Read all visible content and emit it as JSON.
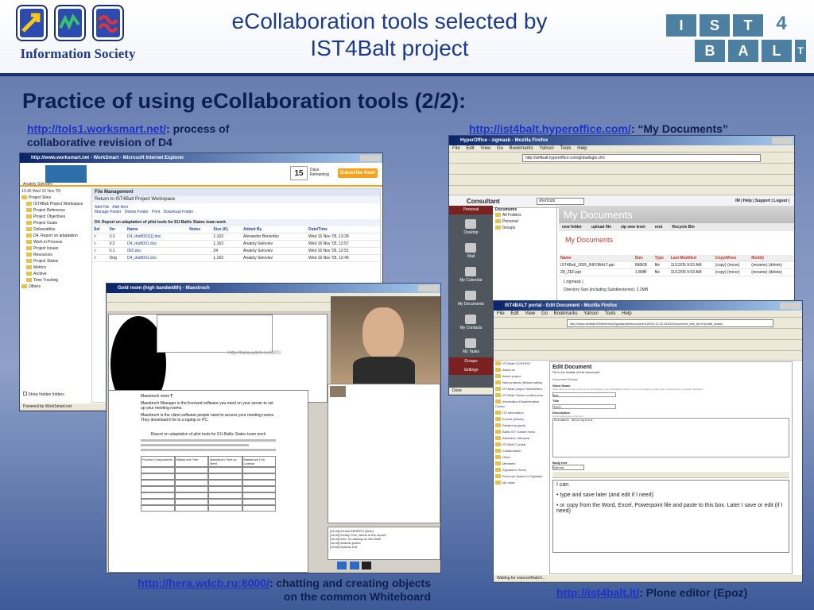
{
  "header": {
    "title_line1": "eCollaboration tools selected by",
    "title_line2": "IST4Balt project",
    "is_logo_text": "Information Society",
    "ist_letters": [
      "I",
      "S",
      "T",
      "4",
      "B",
      "A",
      "L",
      "T"
    ]
  },
  "slide": {
    "subtitle": "Practice of using eCollaboration tools (2/2):",
    "captions": {
      "worksmart_link": "http://tols1.worksmart.net/",
      "worksmart_text": ": process of",
      "worksmart_text2": "collaborative revision of D4",
      "hyperoffice_link": "http://ist4balt.hyperoffice.com/",
      "hyperoffice_text": ": “My Documents”",
      "wdcb_link": "http://hera.wdcb.ru:8000/",
      "wdcb_text": ": chatting and creating objects",
      "wdcb_text2": "on the common Whiteboard",
      "plone_link": "http://ist4balt.lt/",
      "plone_text": ": Plone editor (Epoz)"
    }
  },
  "worksmart": {
    "window_title": "http://www.worksmart.net - WorkSmart - Microsoft Internet Explorer",
    "user_name": "Anatoly Soloviev",
    "user_time": "13:45 Wed 16 Nov '05",
    "days_count": "15",
    "days_label": "Days Remaining",
    "subscribe": "Subscribe Now!",
    "panel_title": "File Management",
    "return_link": "Return to IST4Balt Project Workspace",
    "actions": [
      "Add File",
      "Add Item",
      "Manage Folder",
      "Delete Folder",
      "Print",
      "Download Folder"
    ],
    "report": "D4. Report on adaptation of pilot tools for EU-Baltic States team work",
    "tree": [
      "Project Sites",
      "IST4Balt Project Workspace",
      "Project Reference",
      "Project Objectives",
      "Project Goals",
      "Deliverables",
      "D4. Report on adaptation",
      "Work in Process",
      "Project Issues",
      "Resources",
      "Project Status",
      "Metrics",
      "Archive",
      "Time Tracking",
      "Others"
    ],
    "columns": [
      "Sel",
      "Ver",
      "Name",
      "Notes",
      "Size (K)",
      "Added By",
      "Date/Time"
    ],
    "rows": [
      {
        "ver": "V.3",
        "name": "D4_draft001[1].doc",
        "size": "1,163",
        "by": "Alexander Berisotko",
        "date": "Wed 16 Nov '05, 13:28"
      },
      {
        "ver": "V.2",
        "name": "D4_draft001.doc",
        "size": "1,163",
        "by": "Anatoly Soloviev",
        "date": "Wed 16 Nov '05, 12:57"
      },
      {
        "ver": "V.1",
        "name": "002.doc",
        "size": "24",
        "by": "Anatoly Soloviev",
        "date": "Wed 16 Nov '05, 12:51"
      },
      {
        "ver": "Orig",
        "name": "D4_draft001.doc",
        "size": "1,163",
        "by": "Anatoly Soloviev",
        "date": "Wed 16 Nov '05, 12:49"
      }
    ],
    "show_hidden": "Show hidden folders",
    "status": "Powered by WorkSmart.net"
  },
  "hyperoffice": {
    "window_title": "HyperOffice - zigmasb - Mozilla Firefox",
    "menu": [
      "File",
      "Edit",
      "View",
      "Go",
      "Bookmarks",
      "Yahoo!",
      "Tools",
      "Help"
    ],
    "url": "http://ist4balt.hyperoffice.com/globallogin.cfm",
    "consultant": "Consultant",
    "shortcuts": "shortcuts",
    "side": [
      "Personal",
      "Desktop",
      "Mail",
      "My Calendar",
      "My Documents",
      "My Contacts",
      "My Tasks",
      "Groups",
      "Settings"
    ],
    "folders_title": "Documents",
    "folders": [
      "All Folders",
      "Personal",
      "Groups"
    ],
    "heading": "My Documents",
    "toolbar": [
      "new folder",
      "upload file",
      "zip new level",
      "root",
      "Recycle Bin"
    ],
    "sub_heading": "My Documents",
    "columns": [
      "Name",
      "Size",
      "Type",
      "Last Modified",
      "Copy/Move",
      "Modify"
    ],
    "files": [
      {
        "name": "IST4Balt_2005_INFOBALT.ppt",
        "size": "686KB",
        "type": "file",
        "modified": "11/12/05 9:52 AM",
        "copy": "(copy) (move)",
        "modify": "(rename) (delete)"
      },
      {
        "name": "Z8_ZEF.ppt",
        "size": "1.8MB",
        "type": "file",
        "modified": "11/12/05 9:53 AM",
        "copy": "(copy) (move)",
        "modify": "(rename) (delete)"
      }
    ],
    "zigmasb": "( zigmasb )",
    "dir_size": "Directory Size (including Subdirectories): 2.2MB",
    "links": [
      "IM",
      "Help",
      "Support",
      "Logout"
    ],
    "status": "Done"
  },
  "whiteboard": {
    "window_title": "Gold room (high bandwidth) - Maestroch",
    "board_url": "http://hera.wdcb.ru:8000/",
    "doc_lines": [
      "Maestroch room ¶",
      "Maestroch Manager is the licensed software you need on your server to set up your meeting rooms.",
      "Maestroch is the client software people need to access your meeting rooms. They download it fre to a laptop or PC."
    ],
    "doc_heading": "Report on adaptation of pilot tools for EU-Baltic States team work",
    "table_headers": [
      "Product Components",
      "Maestroch Free",
      "Maestroch Time-to-Meet",
      "Maestroch Full License"
    ],
    "chat_lines": [
      "[16:43] Ernest KEDROV joined",
      "[16:43] Dmitry: Eric, where is the report?",
      "[16:44] Eric: It's already on the Web!",
      "[16:49] Andrew joined",
      "[16:50] Andrew exit"
    ]
  },
  "plone": {
    "window_title": "IST4BALT portal - Edit Document - Mozilla Firefox",
    "menu": [
      "File",
      "Edit",
      "View",
      "Go",
      "Bookmarks",
      "Yahoo!",
      "Tools",
      "Help"
    ],
    "url": "http://www.ist4balt.lt/Members/Zigmasb/test/document.2005-11-22.41522/document_edit_form?portal_status",
    "nav": [
      "IST4Balt CONTENT",
      "About us",
      "About project",
      "New projects (Netsim katba)",
      "IST4Balt project Newsletters",
      "IST4Balt Vilnius conferences",
      "Information Dissemination Center",
      "IT4 information",
      "Events (keiras)",
      "Related projects",
      "Baltic IST market news",
      "Attractive Lithuania",
      "IST4BALT portal",
      "Collaboration",
      "Other",
      "Members",
      "Zigmasb's Home",
      "Personal Space for Zigmasb",
      "My news"
    ],
    "heading": "Edit Document",
    "intro": "Fill in the details of this document.",
    "legend": "Document Details",
    "short_name_label": "Short Name",
    "short_name_hint": "Short name is the part of the item's web address. For accessibility reasons, do not use spaces, upper case, underscores, or special characters.",
    "short_name_value": "test",
    "title_label": "Title",
    "title_value": "TEST",
    "desc_label": "Description",
    "desc_hint": "A brief description of the item.",
    "desc_value": "Document description.",
    "body_label": "Body text",
    "format_value": "Normal",
    "body_lines": [
      "I can",
      "type and save later (and edit if I need)",
      "or copy from the Word, Excel, Powerpoint file and paste to this box. Later I save or edit (if I need)"
    ],
    "status": "Waiting for www.ist4balt.lt..."
  }
}
